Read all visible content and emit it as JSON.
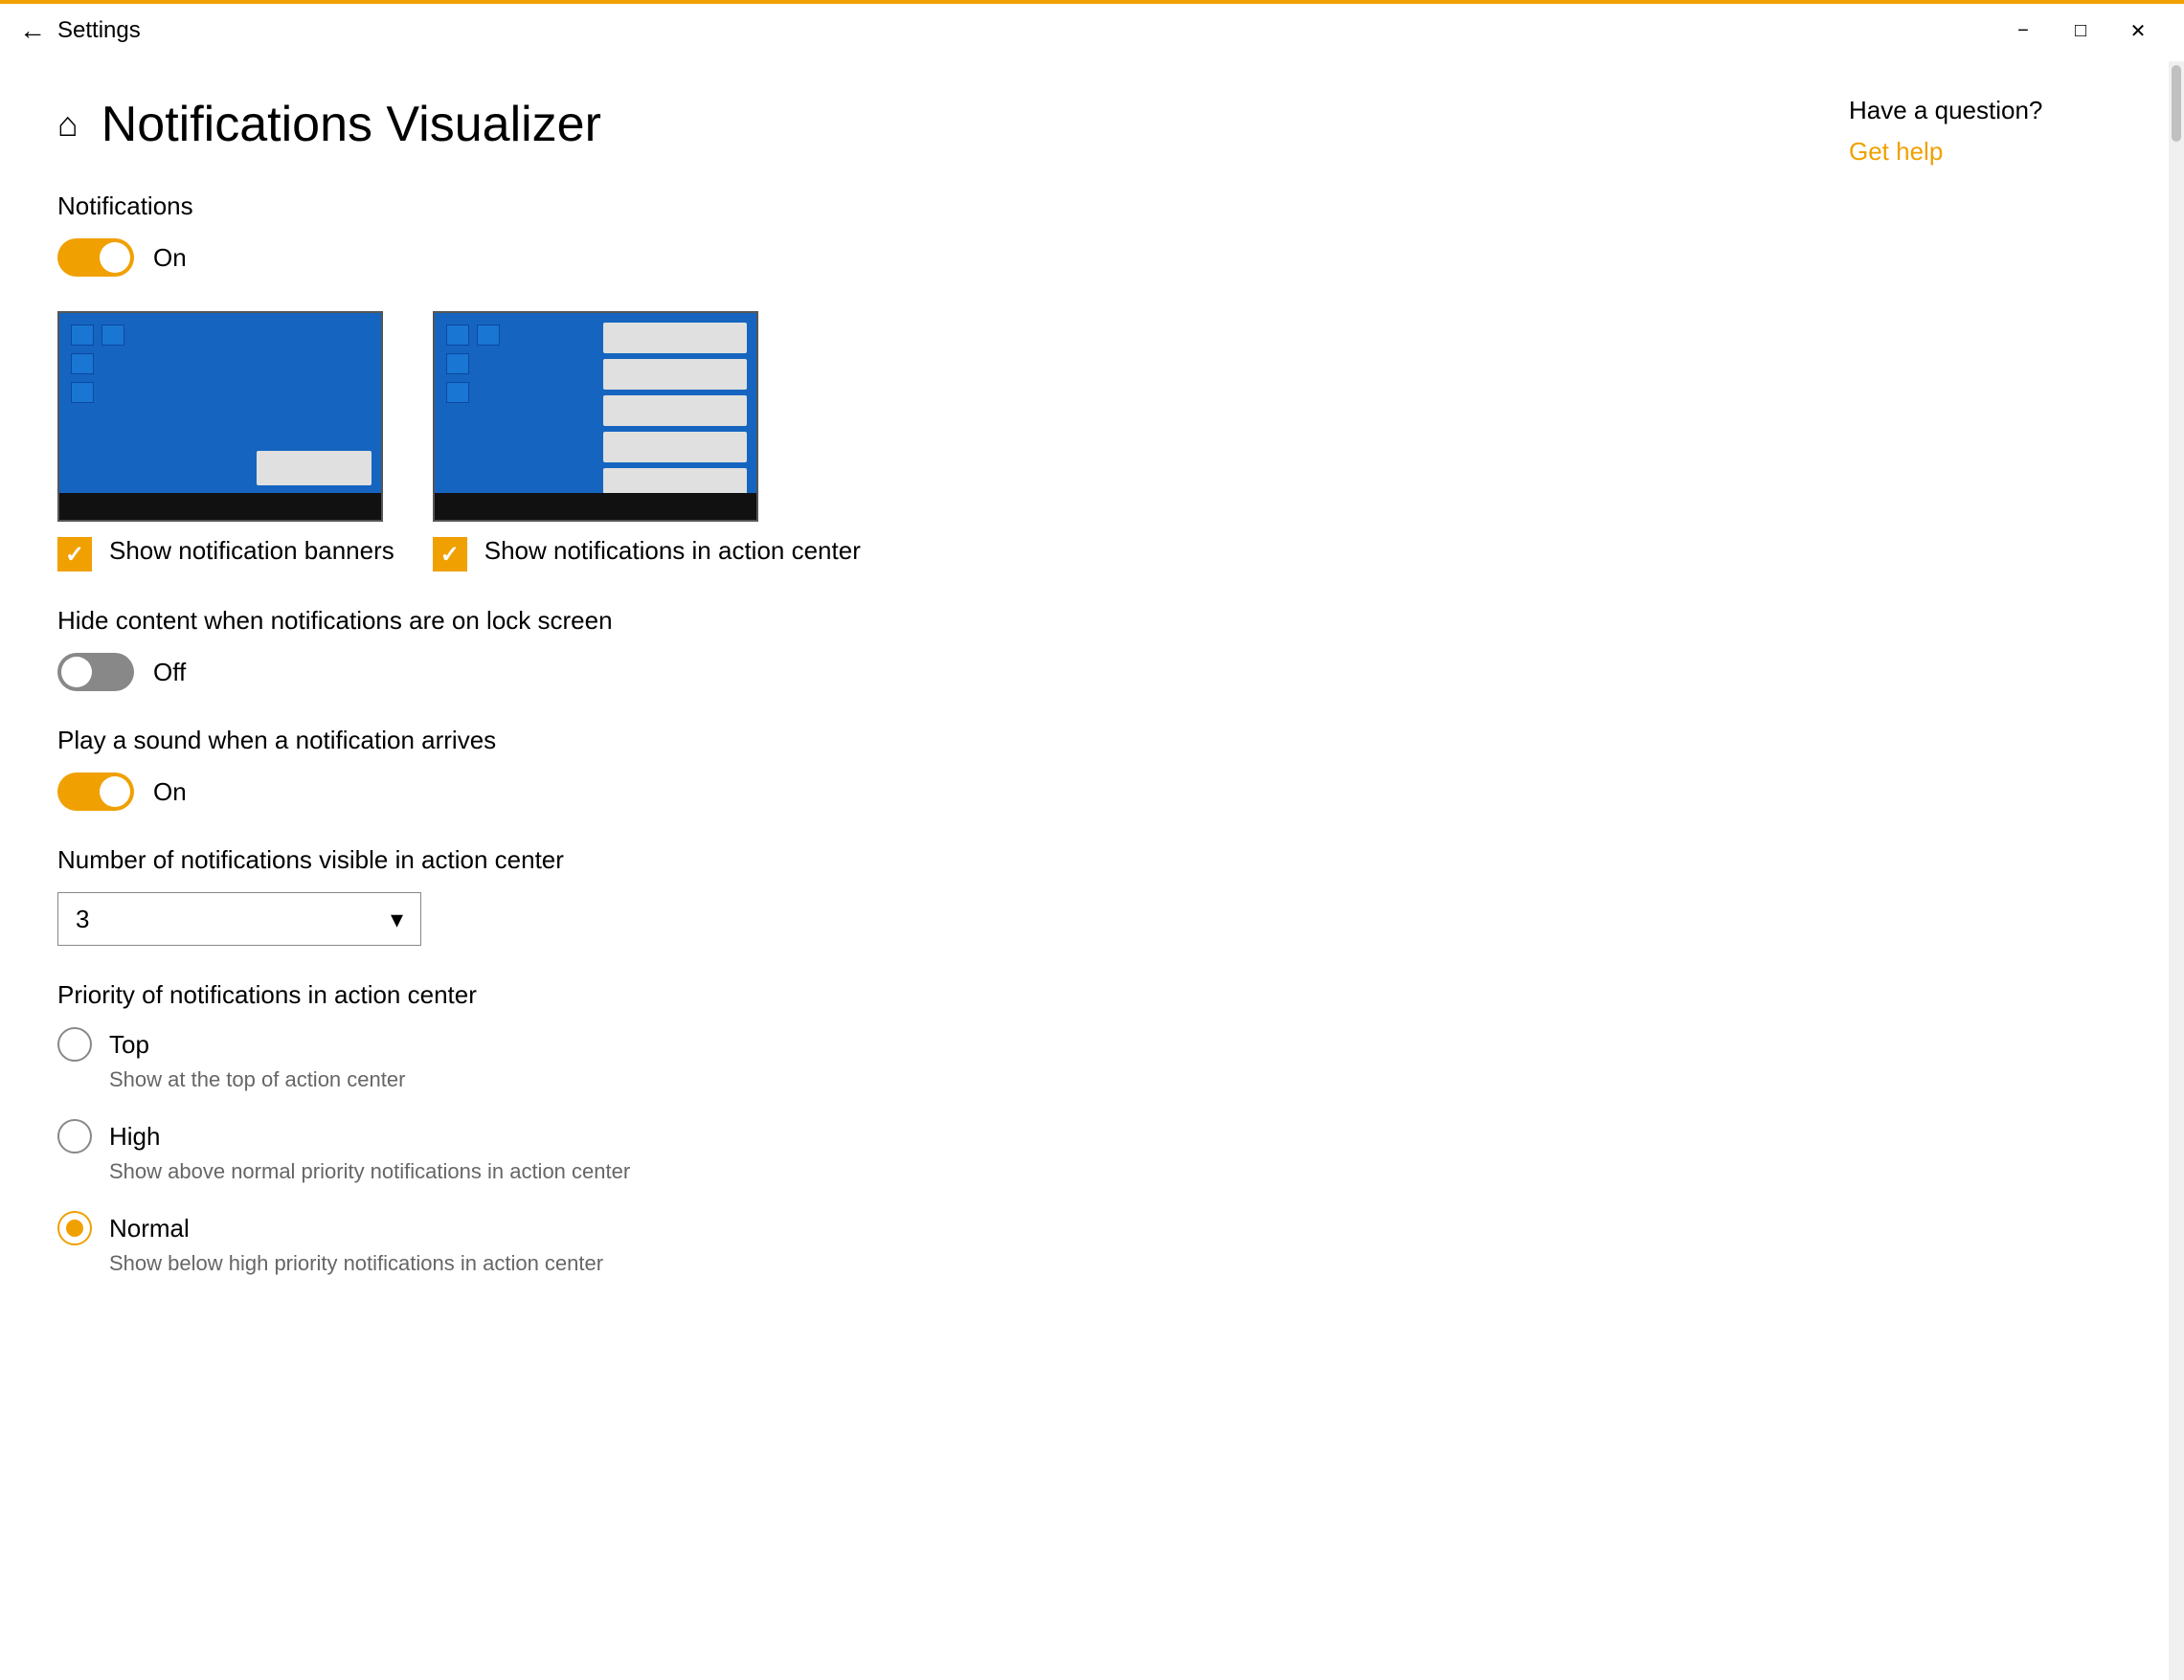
{
  "titlebar": {
    "title": "Settings",
    "minimize_label": "−",
    "maximize_label": "□",
    "close_label": "✕"
  },
  "page": {
    "title": "Notifications Visualizer",
    "back_label": "←"
  },
  "notifications_section": {
    "label": "Notifications",
    "toggle_state": "On",
    "toggle_on": true
  },
  "thumbnail1": {
    "checkbox_checked": true,
    "label": "Show notification banners"
  },
  "thumbnail2": {
    "checkbox_checked": true,
    "label": "Show notifications in action center"
  },
  "hide_content": {
    "label": "Hide content when notifications are on lock screen",
    "toggle_state": "Off",
    "toggle_on": false
  },
  "play_sound": {
    "label": "Play a sound when a notification arrives",
    "toggle_state": "On",
    "toggle_on": true
  },
  "number_visible": {
    "label": "Number of notifications visible in action center",
    "value": "3"
  },
  "priority": {
    "label": "Priority of notifications in action center",
    "options": [
      {
        "value": "Top",
        "description": "Show at the top of action center",
        "selected": false
      },
      {
        "value": "High",
        "description": "Show above normal priority notifications in action center",
        "selected": false
      },
      {
        "value": "Normal",
        "description": "Show below high priority notifications in action center",
        "selected": true
      }
    ]
  },
  "sidebar": {
    "question": "Have a question?",
    "link_label": "Get help"
  }
}
